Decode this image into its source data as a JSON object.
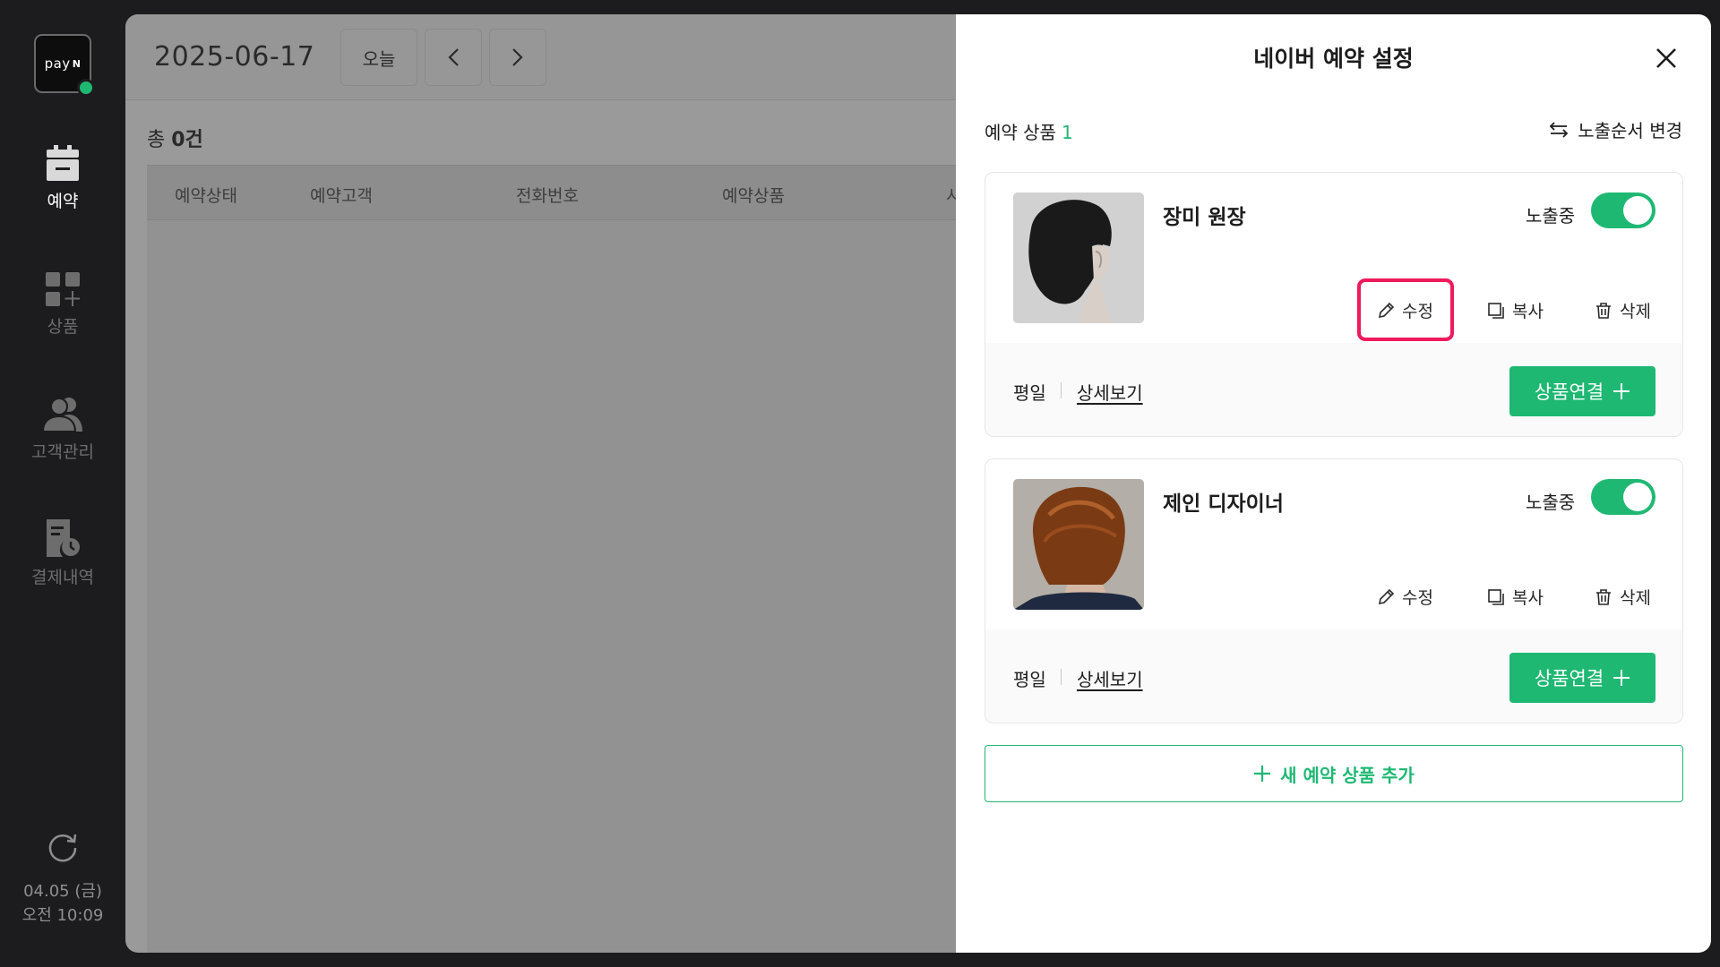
{
  "sidebar": {
    "logo_text": "pay",
    "logo_mark": "N",
    "status_color": "#1fb873",
    "items": [
      {
        "label": "예약",
        "icon": "calendar-icon",
        "active": true
      },
      {
        "label": "상품",
        "icon": "grid-plus-icon",
        "active": false
      },
      {
        "label": "고객관리",
        "icon": "users-icon",
        "active": false
      },
      {
        "label": "결제내역",
        "icon": "receipt-clock-icon",
        "active": false
      }
    ],
    "refresh_icon": "refresh-icon",
    "clock_date": "04.05 (금)",
    "clock_time": "오전 10:09"
  },
  "main": {
    "date": "2025-06-17",
    "today_label": "오늘",
    "total_prefix": "총 ",
    "total_count": "0건",
    "columns": [
      "예약상태",
      "예약고객",
      "전화번호",
      "예약상품",
      "시"
    ]
  },
  "panel": {
    "title": "네이버 예약 설정",
    "section_label": "예약 상품",
    "section_count": "1",
    "order_label": "노출순서 변경",
    "products": [
      {
        "name": "장미 원장",
        "status_label": "노출중",
        "enabled": true,
        "edit_label": "수정",
        "copy_label": "복사",
        "delete_label": "삭제",
        "day_label": "평일",
        "detail_label": "상세보기",
        "connect_label": "상품연결",
        "highlighted_action": "edit"
      },
      {
        "name": "제인 디자이너",
        "status_label": "노출중",
        "enabled": true,
        "edit_label": "수정",
        "copy_label": "복사",
        "delete_label": "삭제",
        "day_label": "평일",
        "detail_label": "상세보기",
        "connect_label": "상품연결"
      }
    ],
    "add_label": "새 예약 상품 추가"
  },
  "colors": {
    "accent": "#1fb873",
    "highlight": "#f01a5d",
    "sidebar_bg": "#1c1c1e"
  }
}
